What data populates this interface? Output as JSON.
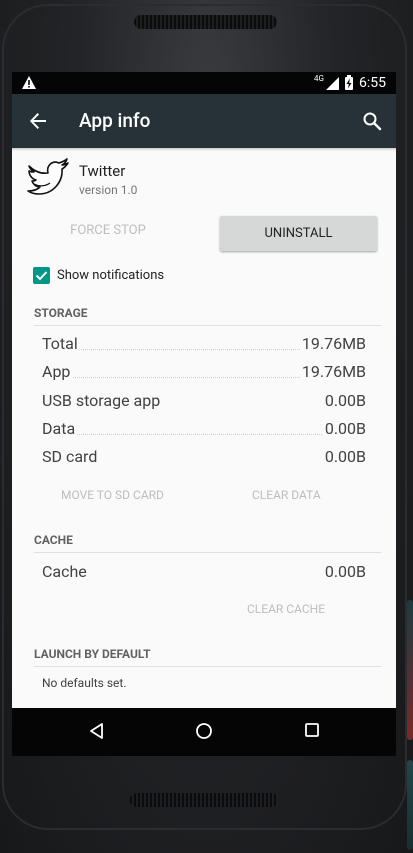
{
  "status_bar": {
    "network": "4G",
    "time": "6:55"
  },
  "toolbar": {
    "title": "App info"
  },
  "app": {
    "name": "Twitter",
    "version": "version 1.0"
  },
  "actions": {
    "force_stop": "FORCE STOP",
    "uninstall": "UNINSTALL"
  },
  "notifications": {
    "label": "Show notifications",
    "checked": true
  },
  "storage": {
    "header": "STORAGE",
    "rows": [
      {
        "label": "Total",
        "value": "19.76MB"
      },
      {
        "label": "App",
        "value": "19.76MB"
      },
      {
        "label": "USB storage app",
        "value": "0.00B"
      },
      {
        "label": "Data",
        "value": "0.00B"
      },
      {
        "label": "SD card",
        "value": "0.00B"
      }
    ],
    "move_to_sd": "MOVE TO SD CARD",
    "clear_data": "CLEAR DATA"
  },
  "cache": {
    "header": "CACHE",
    "row": {
      "label": "Cache",
      "value": "0.00B"
    },
    "clear_cache": "CLEAR CACHE"
  },
  "launch": {
    "header": "LAUNCH BY DEFAULT",
    "text": "No defaults set."
  },
  "colors": {
    "toolbar": "#263238",
    "accent": "#009688",
    "status_bar": "#050505"
  },
  "icons": [
    "warning-icon",
    "signal-icon",
    "battery-icon",
    "back-arrow-icon",
    "search-icon",
    "twitter-logo-icon",
    "check-icon",
    "nav-back-icon",
    "nav-home-icon",
    "nav-recents-icon"
  ]
}
